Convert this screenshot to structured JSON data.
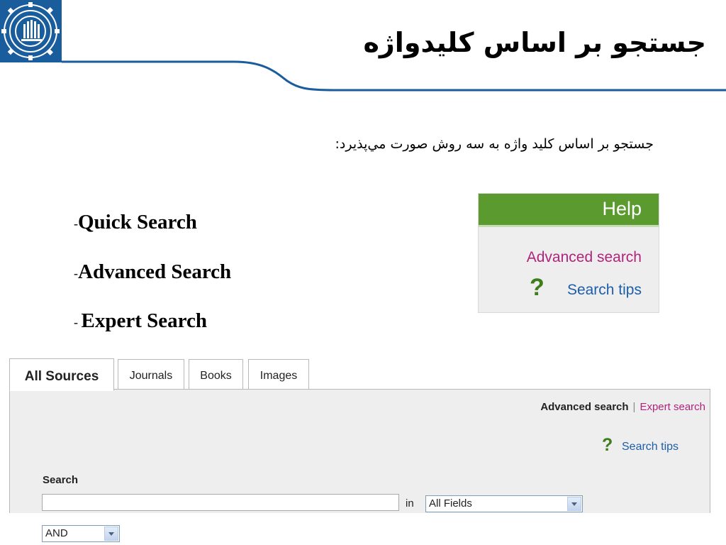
{
  "slide": {
    "title": "جستجو بر اساس کلیدواژه",
    "subtitle": "جستجو بر اساس كليد واژه به سه روش صورت مي‌پذيرد:"
  },
  "search_types": [
    {
      "dash": "-",
      "label": "Quick Search"
    },
    {
      "dash": "-",
      "label": "Advanced Search"
    },
    {
      "dash": "- ",
      "label": "Expert Search"
    }
  ],
  "help_box": {
    "title": "Help",
    "advanced_link": "Advanced search",
    "tips_icon": "?",
    "tips_link": "Search tips",
    "colors": {
      "header": "#5b9a2e",
      "advanced": "#b0247c",
      "tips": "#1d5ea8"
    }
  },
  "search_panel": {
    "tabs": [
      {
        "label": "All Sources",
        "active": true
      },
      {
        "label": "Journals",
        "active": false
      },
      {
        "label": "Books",
        "active": false
      },
      {
        "label": "Images",
        "active": false
      }
    ],
    "advanced_link": "Advanced search",
    "separator": "|",
    "expert_link": "Expert search",
    "tips_icon": "?",
    "tips_link": "Search tips",
    "search_label": "Search",
    "search_value": "",
    "in_label": "in",
    "field_select": "All Fields",
    "boolean_select": "AND"
  },
  "icons": {
    "logo": "university-gear-emblem-icon",
    "tips": "question-mark-icon",
    "dropdown": "chevron-down-icon"
  }
}
